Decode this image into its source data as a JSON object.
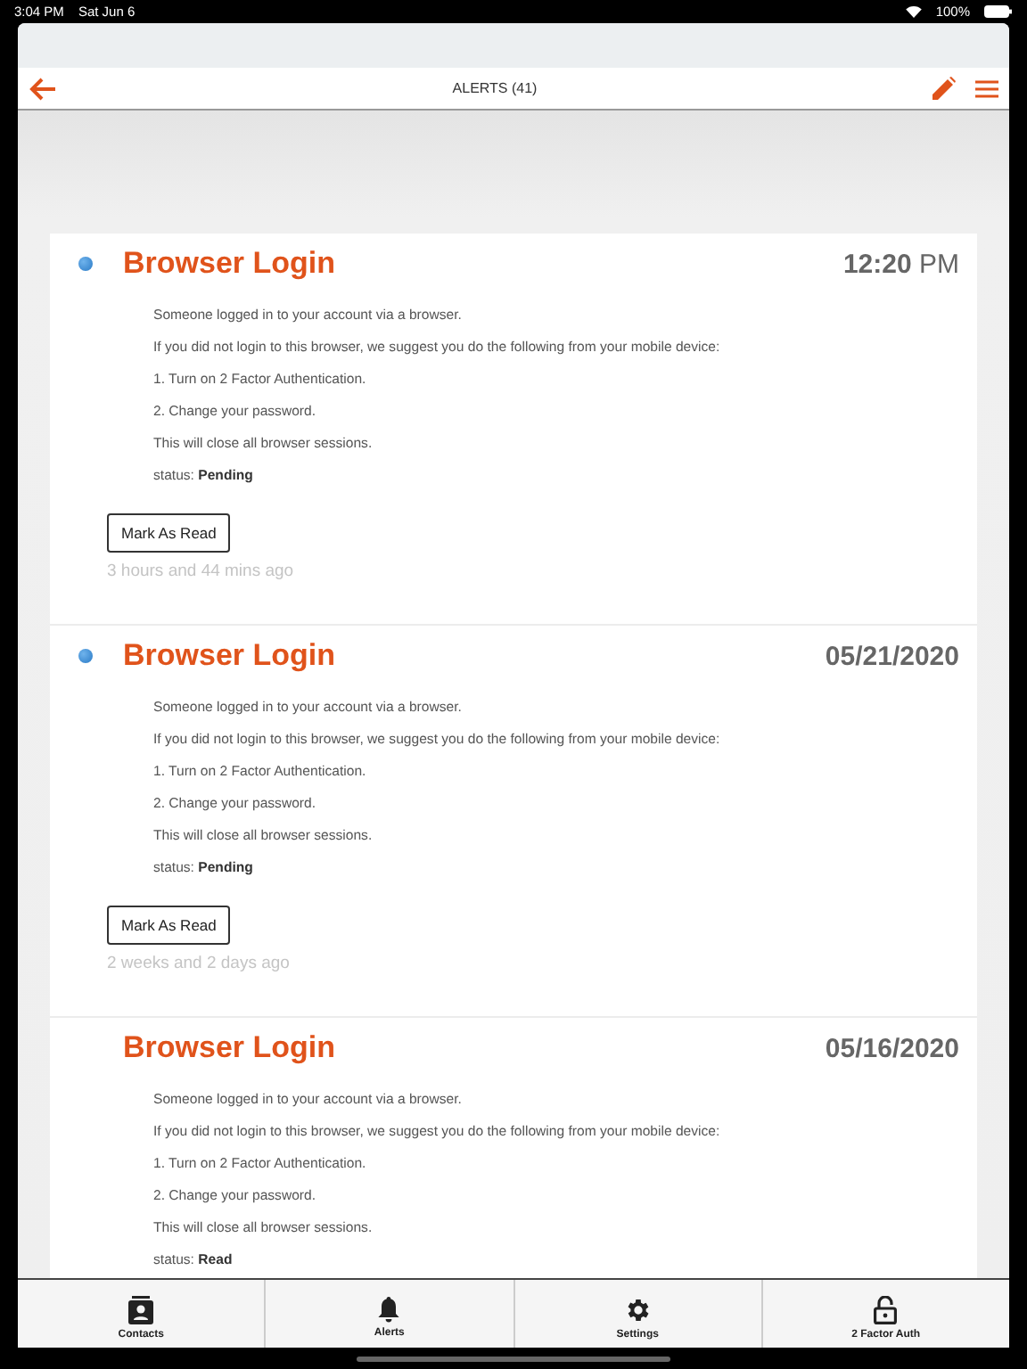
{
  "status_bar": {
    "time": "3:04 PM",
    "date": "Sat Jun 6",
    "battery": "100%"
  },
  "nav": {
    "title": "ALERTS (41)"
  },
  "alerts": [
    {
      "unread": true,
      "title": "Browser Login",
      "when": "**12:20** PM",
      "lines": [
        "Someone logged in to your account via a browser.",
        "If you did not login to this browser, we suggest you do the following from your mobile device:",
        "1. Turn on 2 Factor Authentication.",
        "2. Change your password.",
        "This will close all browser sessions.",
        "status: **Pending**"
      ],
      "button": "Mark As Read",
      "ago": "3 hours and 44 mins ago"
    },
    {
      "unread": true,
      "title": "Browser Login",
      "when": "**05/21/2020**",
      "lines": [
        "Someone logged in to your account via a browser.",
        "If you did not login to this browser, we suggest you do the following from your mobile device:",
        "1. Turn on 2 Factor Authentication.",
        "2. Change your password.",
        "This will close all browser sessions.",
        "status: **Pending**"
      ],
      "button": "Mark As Read",
      "ago": "2 weeks and 2 days ago"
    },
    {
      "unread": false,
      "title": "Browser Login",
      "when": "**05/16/2020**",
      "lines": [
        "Someone logged in to your account via a browser.",
        "If you did not login to this browser, we suggest you do the following from your mobile device:",
        "1. Turn on 2 Factor Authentication.",
        "2. Change your password.",
        "This will close all browser sessions.",
        "status: **Read**"
      ]
    }
  ],
  "tabs": [
    {
      "kind": "contacts",
      "label": "Contacts"
    },
    {
      "kind": "alerts",
      "label": "Alerts"
    },
    {
      "kind": "settings",
      "label": "Settings"
    },
    {
      "kind": "lock",
      "label": "2 Factor Auth"
    }
  ]
}
